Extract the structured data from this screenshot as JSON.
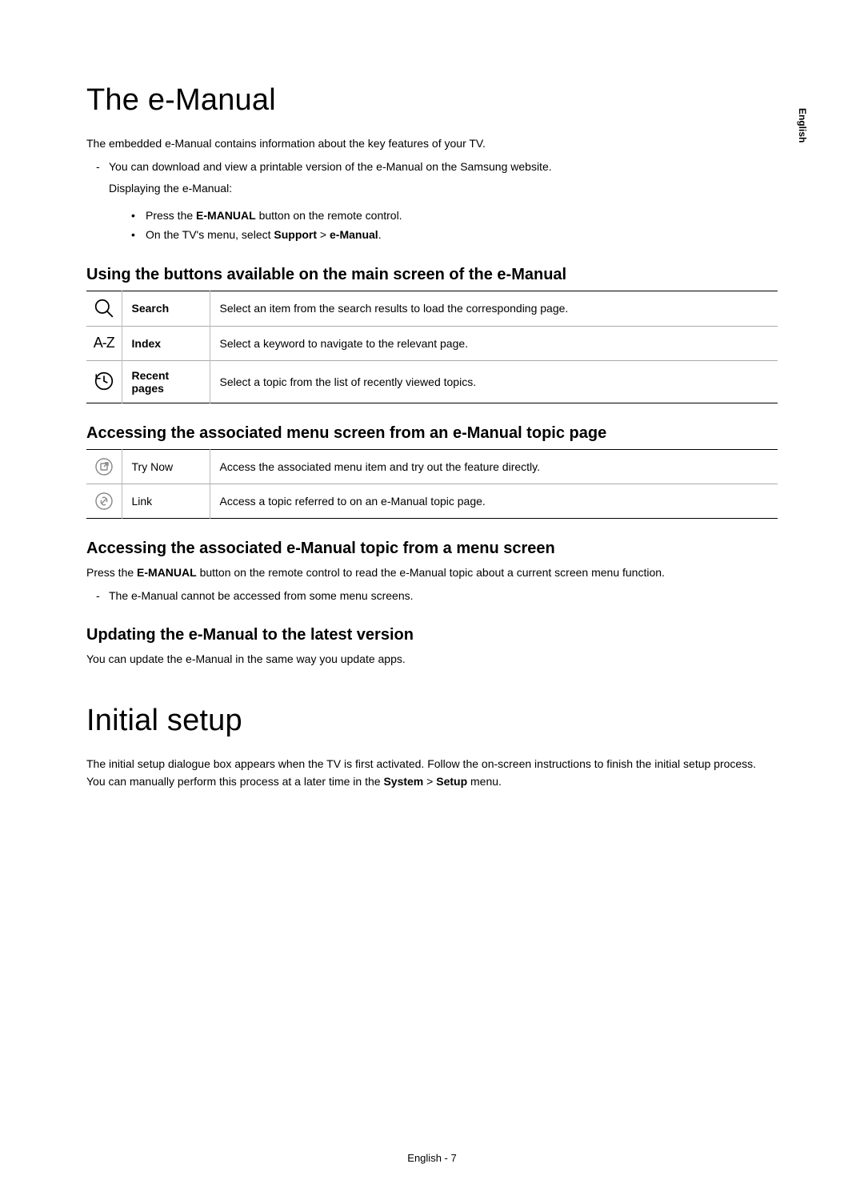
{
  "side_tab": "English",
  "page_footer": "English - 7",
  "section1": {
    "title": "The e-Manual",
    "intro": "The embedded e-Manual contains information about the key features of your TV.",
    "dash1_pre": "You can download and view a printable version of the e-Manual on the Samsung website.",
    "dash1_sub": "Displaying the e-Manual:",
    "bullet1_pre": "Press the ",
    "bullet1_b": "E-MANUAL",
    "bullet1_post": " button on the remote control.",
    "bullet2_pre": "On the TV's menu, select ",
    "bullet2_b1": "Support",
    "bullet2_mid": " > ",
    "bullet2_b2": "e-Manual",
    "bullet2_post": "."
  },
  "sub1": {
    "heading": "Using the buttons available on the main screen of the e-Manual",
    "rows": {
      "search": {
        "label": "Search",
        "desc": "Select an item from the search results to load the corresponding page."
      },
      "index": {
        "label": "Index",
        "desc": "Select a keyword to navigate to the relevant page."
      },
      "recent": {
        "label": "Recent pages",
        "desc": "Select a topic from the list of recently viewed topics."
      }
    },
    "index_icon_text": "A-Z"
  },
  "sub2": {
    "heading": "Accessing the associated menu screen from an e-Manual topic page",
    "rows": {
      "trynow": {
        "label": "Try Now",
        "desc": "Access the associated menu item and try out the feature directly."
      },
      "link": {
        "label": "Link",
        "desc": "Access a topic referred to on an e-Manual topic page."
      }
    }
  },
  "sub3": {
    "heading": "Accessing the associated e-Manual topic from a menu screen",
    "line_pre": "Press the ",
    "line_b": "E-MANUAL",
    "line_post": " button on the remote control to read the e-Manual topic about a current screen menu function.",
    "dash": "The e-Manual cannot be accessed from some menu screens."
  },
  "sub4": {
    "heading": "Updating the e-Manual to the latest version",
    "line": "You can update the e-Manual in the same way you update apps."
  },
  "section2": {
    "title": "Initial setup",
    "line_pre": "The initial setup dialogue box appears when the TV is first activated. Follow the on-screen instructions to finish the initial setup process. You can manually perform this process at a later time in the ",
    "b1": "System",
    "mid": " > ",
    "b2": "Setup",
    "post": " menu."
  }
}
